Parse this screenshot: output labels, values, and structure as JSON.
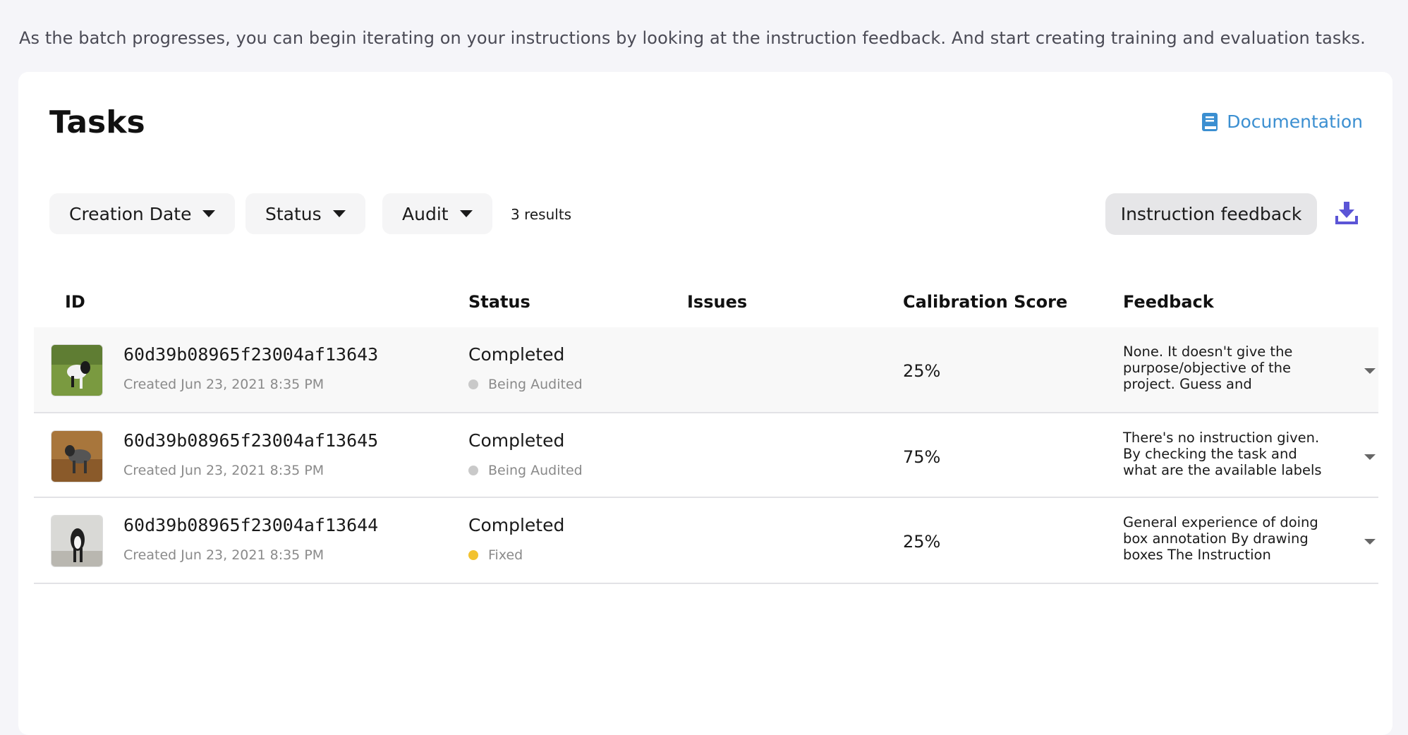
{
  "intro": "As the batch progresses, you can begin iterating on your instructions by looking at the instruction feedback. And start creating training and evaluation tasks.",
  "card": {
    "title": "Tasks",
    "documentation_label": "Documentation"
  },
  "filters": {
    "creation_date": "Creation Date",
    "status": "Status",
    "audit": "Audit",
    "results": "3 results"
  },
  "actions": {
    "instruction_feedback": "Instruction feedback"
  },
  "columns": {
    "id": "ID",
    "status": "Status",
    "issues": "Issues",
    "calibration": "Calibration Score",
    "feedback": "Feedback"
  },
  "rows": [
    {
      "id": "60d39b08965f23004af13643",
      "created": "Created Jun 23, 2021 8:35 PM",
      "status": "Completed",
      "audit": "Being Audited",
      "audit_color": "#c9c9c9",
      "issues": "",
      "score": "25%",
      "feedback": "None. It doesn't give the purpose/objective of the project. Guess and"
    },
    {
      "id": "60d39b08965f23004af13645",
      "created": "Created Jun 23, 2021 8:35 PM",
      "status": "Completed",
      "audit": "Being Audited",
      "audit_color": "#c9c9c9",
      "issues": "",
      "score": "75%",
      "feedback": "There's no instruction given. By checking the task and what are the available labels"
    },
    {
      "id": "60d39b08965f23004af13644",
      "created": "Created Jun 23, 2021 8:35 PM",
      "status": "Completed",
      "audit": "Fixed",
      "audit_color": "#f2c230",
      "issues": "",
      "score": "25%",
      "feedback": "General experience of doing box annotation By drawing boxes The Instruction"
    }
  ],
  "colors": {
    "link": "#3b8fd1",
    "download_icon": "#5b55d6",
    "being_audited": "#c9c9c9",
    "fixed": "#f2c230"
  }
}
